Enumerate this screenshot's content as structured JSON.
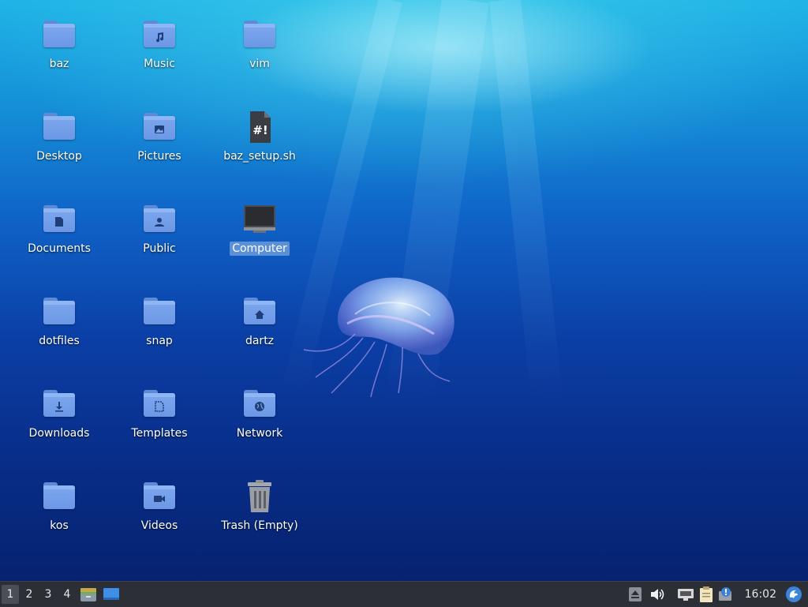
{
  "desktop": {
    "icons": [
      {
        "label": "baz",
        "type": "folder",
        "emblem": ""
      },
      {
        "label": "Music",
        "type": "folder",
        "emblem": "music-note-icon"
      },
      {
        "label": "vim",
        "type": "folder",
        "emblem": ""
      },
      {
        "label": "Desktop",
        "type": "folder",
        "emblem": ""
      },
      {
        "label": "Pictures",
        "type": "folder",
        "emblem": "picture-icon"
      },
      {
        "label": "baz_setup.sh",
        "type": "script-file",
        "emblem": "#!"
      },
      {
        "label": "Documents",
        "type": "folder",
        "emblem": "document-icon"
      },
      {
        "label": "Public",
        "type": "folder",
        "emblem": "person-icon"
      },
      {
        "label": "Computer",
        "type": "computer",
        "emblem": "monitor-icon",
        "selected": true
      },
      {
        "label": "dotfiles",
        "type": "folder",
        "emblem": ""
      },
      {
        "label": "snap",
        "type": "folder",
        "emblem": ""
      },
      {
        "label": "dartz",
        "type": "folder",
        "emblem": "home-icon"
      },
      {
        "label": "Downloads",
        "type": "folder",
        "emblem": "download-arrow-icon"
      },
      {
        "label": "Templates",
        "type": "folder",
        "emblem": "template-icon"
      },
      {
        "label": "Network",
        "type": "folder",
        "emblem": "globe-icon"
      },
      {
        "label": "kos",
        "type": "folder",
        "emblem": ""
      },
      {
        "label": "Videos",
        "type": "folder",
        "emblem": "video-camera-icon"
      },
      {
        "label": "Trash (Empty)",
        "type": "trash",
        "emblem": "trash-can-icon"
      }
    ]
  },
  "taskbar": {
    "workspaces": [
      "1",
      "2",
      "3",
      "4"
    ],
    "active_workspace": "1",
    "launchers": [
      "file-manager-icon",
      "show-desktop-icon"
    ],
    "tray": [
      "eject-icon",
      "volume-icon",
      "network-icon",
      "clipboard-icon",
      "notification-icon"
    ],
    "clock": "16:02",
    "menu_icon": "xubuntu-logo-icon"
  },
  "colors": {
    "folder": "#7ea8ee",
    "selection": "#5b8fd6",
    "panel": "#2c2f36"
  }
}
